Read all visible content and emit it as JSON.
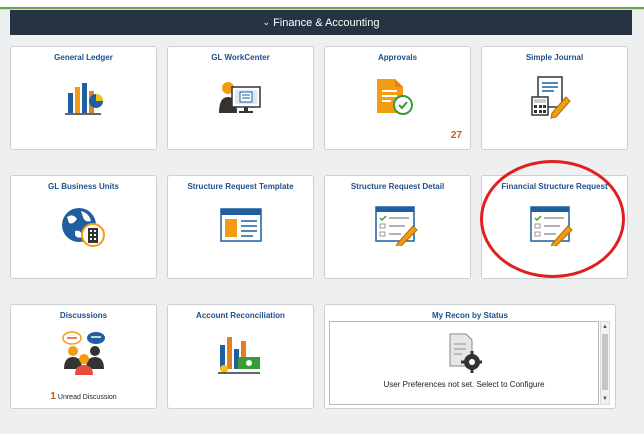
{
  "header": {
    "title": "Finance & Accounting"
  },
  "tiles": [
    {
      "title": "General Ledger"
    },
    {
      "title": "GL WorkCenter"
    },
    {
      "title": "Approvals",
      "count": "27"
    },
    {
      "title": "Simple Journal"
    },
    {
      "title": "GL Business Units"
    },
    {
      "title": "Structure Request Template"
    },
    {
      "title": "Structure Request Detail"
    },
    {
      "title": "Financial Structure Request"
    },
    {
      "title": "Discussions",
      "unread_count": "1",
      "unread_label": "Unread Discussion"
    },
    {
      "title": "Account Reconciliation"
    }
  ],
  "recon": {
    "title": "My Recon by Status",
    "message": "User Preferences not set. Select to Configure"
  },
  "colors": {
    "header_bg": "#253342",
    "title_blue": "#1d4f8a",
    "accent_orange": "#c45a17",
    "highlight_red": "#e02020"
  }
}
